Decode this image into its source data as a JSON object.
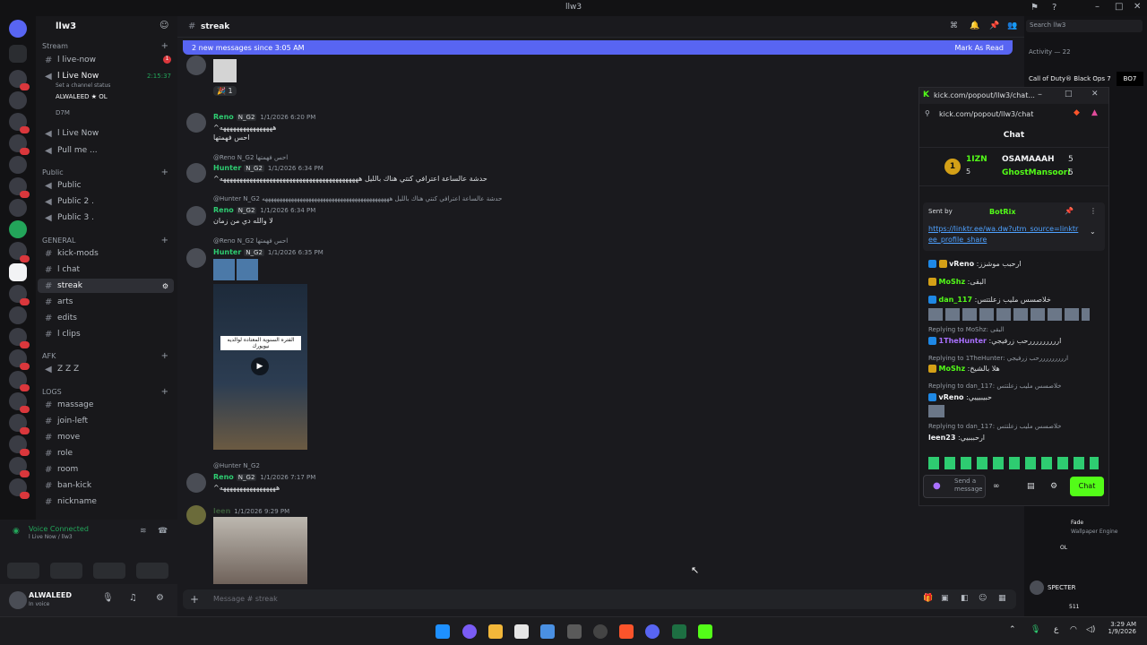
{
  "window": {
    "title": "llw3"
  },
  "server": {
    "name": "llw3"
  },
  "categories": {
    "stream": "Stream",
    "public": "Public",
    "general": "GENERAL",
    "afk": "AFK",
    "logs": "LOGS"
  },
  "channels": {
    "live_now": "l live-now",
    "live_now_voice": "l Live Now",
    "channel_status": "Set a channel status",
    "voice_time": "2:15:37",
    "user1": "ALWALEED ★",
    "user1_tag": "OL",
    "user2": "D7M",
    "live_now2": "l Live Now",
    "pull_me": "Pull me ...",
    "public": "Public",
    "public2": "Public 2 .",
    "public3": "Public 3 .",
    "kick_mods": "kick-mods",
    "chat": "l chat",
    "streak": "streak",
    "arts": "arts",
    "edits": "edits",
    "clips": "l clips",
    "zzz": "Z Z Z",
    "massage": "massage",
    "join_left": "join-left",
    "move": "move",
    "role": "role",
    "room": "room",
    "ban_kick": "ban-kick",
    "nickname": "nickname"
  },
  "unread_count": "1",
  "voice": {
    "status": "Voice Connected",
    "location": "l Live Now / llw3"
  },
  "user": {
    "name": "ALWALEED",
    "status": "In voice"
  },
  "header": {
    "channel": "streak",
    "search_placeholder": "Search llw3"
  },
  "banner": {
    "text": "2 new messages since 3:05 AM",
    "action": "Mark As Read"
  },
  "messages": [
    {
      "author": "Reno",
      "tag": "N_G2",
      "time": "1/1/2026 6:20 PM",
      "line1": "^ههههههههههههههههه",
      "line2": "احس فهمتها"
    },
    {
      "reply": "@Reno N_G2 احس فهمتها",
      "author": "Hunter",
      "tag": "N_G2",
      "time": "1/1/2026 6:34 PM",
      "line1": "^حدشة عالساعة اعترافي كنتي هناك بالليل ههههههههههههههههههههههههههههههههههههههههههه"
    },
    {
      "reply": "@Hunter N_G2 حدشة عالساعة اعترافي كنتي هناك بالليل ههههههههههههههههههههههههههههههههههههههههههههه",
      "author": "Reno",
      "tag": "N_G2",
      "time": "1/1/2026 6:34 PM",
      "line1": "لا والله دي من زمان"
    },
    {
      "reply": "@Reno N_G2 احس فهمتها",
      "author": "Hunter",
      "tag": "N_G2",
      "time": "1/1/2026 6:35 PM",
      "video_caption": "الفتره السنوية المعتاده لوالديه نيويورك"
    },
    {
      "reply": "@Hunter N_G2",
      "author": "Reno",
      "tag": "N_G2",
      "time": "1/1/2026 7:17 PM",
      "line1": "^هههههههههههههههههه"
    },
    {
      "author": "leen",
      "time": "1/1/2026 9:29 PM"
    }
  ],
  "reaction_count": "1",
  "composer": {
    "placeholder": "Message # streak"
  },
  "rightbar": {
    "activity": "Activity — 22",
    "game": "Call of Duty® Black Ops 7",
    "app": "Wallpaper Engine",
    "user_a": "Fade",
    "user_b": "OL",
    "user_c": "SPECTER",
    "user_d": "511"
  },
  "popout": {
    "title": "kick.com/popout/llw3/chat...",
    "url": "kick.com/popout/llw3/chat",
    "heading": "Chat",
    "leader_rank": "1",
    "leader_name": "1IZN",
    "leader_sub1": "5",
    "gift1_name": "OSAMAAAH",
    "gift1_val": "5",
    "gift2_name": "GhostMansoori",
    "gift2_val": "5",
    "pinned_by": "Sent by",
    "pinned_author": "BotRix",
    "pinned_link": "https://linktr.ee/wa.dw?utm_source=linktree_profile_share",
    "chat": [
      {
        "name": "vReno",
        "text": ":ارحبب موشزز"
      },
      {
        "name": "MoShz",
        "text": ":البقى"
      },
      {
        "name": "dan_117",
        "text": ":خلاصسس مليب زعلتتس"
      },
      {
        "reply": "Replying to MoShz: البقى"
      },
      {
        "name": "1TheHunter",
        "text": ":ارررررررررحب زرفيجي"
      },
      {
        "reply": "Replying to 1TheHunter: ارررررررررحب زرفيجي"
      },
      {
        "name": "MoShz",
        "text": ":هلا بالشيخ"
      },
      {
        "reply": "Replying to dan_117: خلاصسس مليب زعلتتس"
      },
      {
        "name": "vReno",
        "text": ":حبيبيييي"
      },
      {
        "reply": "Replying to dan_117: خلاصسس مليب زعلتتس"
      },
      {
        "name": "leen23",
        "text": ":ارحبببيي"
      }
    ],
    "input_placeholder": "Send a message",
    "send_label": "Chat"
  },
  "taskbar": {
    "time": "3:29 AM",
    "date": "1/9/2026",
    "lang": "ع"
  }
}
